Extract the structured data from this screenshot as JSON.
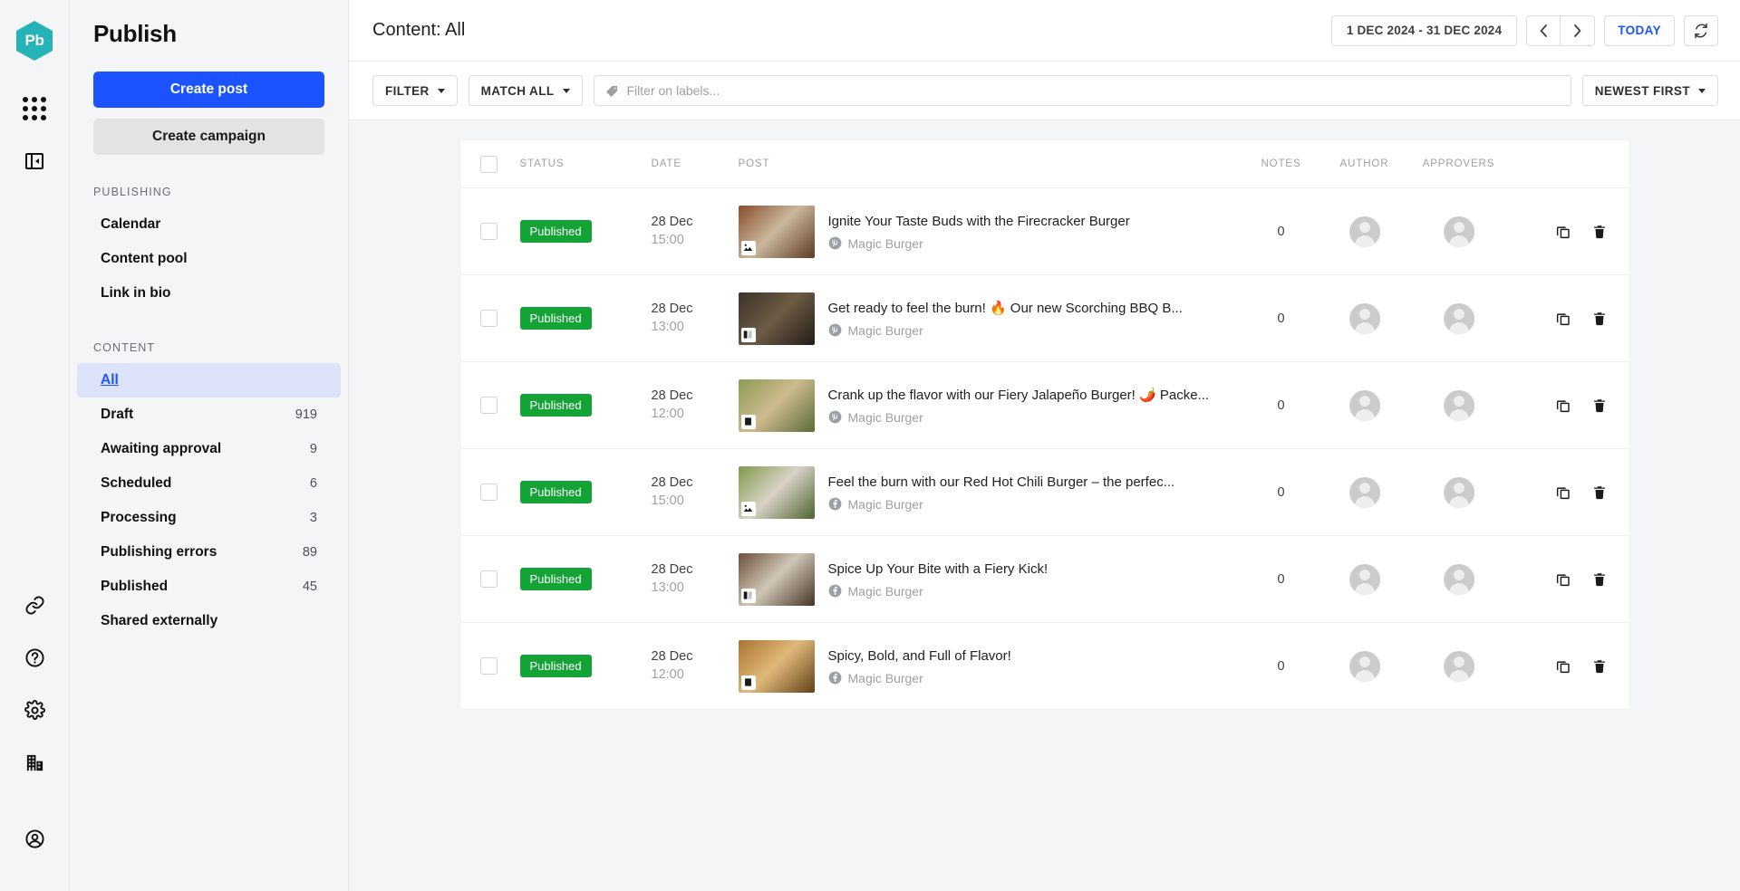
{
  "rail": {
    "logo_text": "Pb",
    "logo_color": "#26b3b8",
    "icons": [
      {
        "name": "apps-grid-icon"
      },
      {
        "name": "collapse-panel-icon"
      }
    ],
    "bottom_icons": [
      {
        "name": "link-icon"
      },
      {
        "name": "help-icon"
      },
      {
        "name": "gear-icon"
      },
      {
        "name": "company-icon"
      },
      {
        "name": "account-icon"
      }
    ]
  },
  "sidebar": {
    "title": "Publish",
    "create_post_label": "Create post",
    "create_campaign_label": "Create campaign",
    "groups": [
      {
        "label": "PUBLISHING",
        "items": [
          {
            "label": "Calendar",
            "count": ""
          },
          {
            "label": "Content pool",
            "count": ""
          },
          {
            "label": "Link in bio",
            "count": ""
          }
        ]
      },
      {
        "label": "CONTENT",
        "items": [
          {
            "label": "All",
            "count": "",
            "active": true
          },
          {
            "label": "Draft",
            "count": "919"
          },
          {
            "label": "Awaiting approval",
            "count": "9"
          },
          {
            "label": "Scheduled",
            "count": "6"
          },
          {
            "label": "Processing",
            "count": "3"
          },
          {
            "label": "Publishing errors",
            "count": "89"
          },
          {
            "label": "Published",
            "count": "45"
          },
          {
            "label": "Shared externally",
            "count": ""
          }
        ]
      }
    ]
  },
  "header": {
    "page_title": "Content: All",
    "date_range": "1 DEC 2024  -  31 DEC 2024",
    "prev_label": "‹",
    "next_label": "›",
    "today_label": "TODAY",
    "refresh_icon": "refresh-icon"
  },
  "filterbar": {
    "filter_label": "FILTER",
    "match_label": "MATCH ALL",
    "labels_placeholder": "Filter on labels...",
    "sort_label": "NEWEST FIRST"
  },
  "table": {
    "columns": {
      "status": "STATUS",
      "date": "DATE",
      "post": "POST",
      "notes": "NOTES",
      "author": "AUTHOR",
      "approvers": "APPROVERS"
    },
    "rows": [
      {
        "status": "Published",
        "date": "28 Dec",
        "time": "15:00",
        "title": "Ignite Your Taste Buds with the Firecracker Burger",
        "network": "pinterest",
        "account": "Magic Burger",
        "notes": "0",
        "thumb_colors": [
          "#8a4c2a",
          "#c9b79c",
          "#5e3b22"
        ],
        "thumb_badge": "image-badge"
      },
      {
        "status": "Published",
        "date": "28 Dec",
        "time": "13:00",
        "title": "Get ready to feel the burn! 🔥 Our new Scorching BBQ B...",
        "network": "pinterest",
        "account": "Magic Burger",
        "notes": "0",
        "thumb_colors": [
          "#3b3228",
          "#6d5c45",
          "#241d17"
        ],
        "thumb_badge": "carousel-badge"
      },
      {
        "status": "Published",
        "date": "28 Dec",
        "time": "12:00",
        "title": "Crank up the flavor with our Fiery Jalapeño Burger! 🌶️ Packe...",
        "network": "pinterest",
        "account": "Magic Burger",
        "notes": "0",
        "thumb_colors": [
          "#8d9a53",
          "#cdbb8e",
          "#5c6a38"
        ],
        "thumb_badge": "blank-badge"
      },
      {
        "status": "Published",
        "date": "28 Dec",
        "time": "15:00",
        "title": "Feel the burn with our Red Hot Chili Burger – the perfec...",
        "network": "facebook",
        "account": "Magic Burger",
        "notes": "0",
        "thumb_colors": [
          "#7f9a4a",
          "#d8d2c6",
          "#4e6330"
        ],
        "thumb_badge": "image-badge"
      },
      {
        "status": "Published",
        "date": "28 Dec",
        "time": "13:00",
        "title": "Spice Up Your Bite with a Fiery Kick!",
        "network": "facebook",
        "account": "Magic Burger",
        "notes": "0",
        "thumb_colors": [
          "#6d5139",
          "#cfc6b6",
          "#463323"
        ],
        "thumb_badge": "carousel-badge"
      },
      {
        "status": "Published",
        "date": "28 Dec",
        "time": "12:00",
        "title": "Spicy, Bold, and Full of Flavor!",
        "network": "facebook",
        "account": "Magic Burger",
        "notes": "0",
        "thumb_colors": [
          "#a9752f",
          "#e0b878",
          "#63421a"
        ],
        "thumb_badge": "blank-badge"
      }
    ],
    "actions": {
      "duplicate": "duplicate-icon",
      "delete": "delete-icon"
    }
  },
  "colors": {
    "accent": "#1a53ff",
    "published_green": "#14a436",
    "logo_teal": "#26b3b8"
  }
}
